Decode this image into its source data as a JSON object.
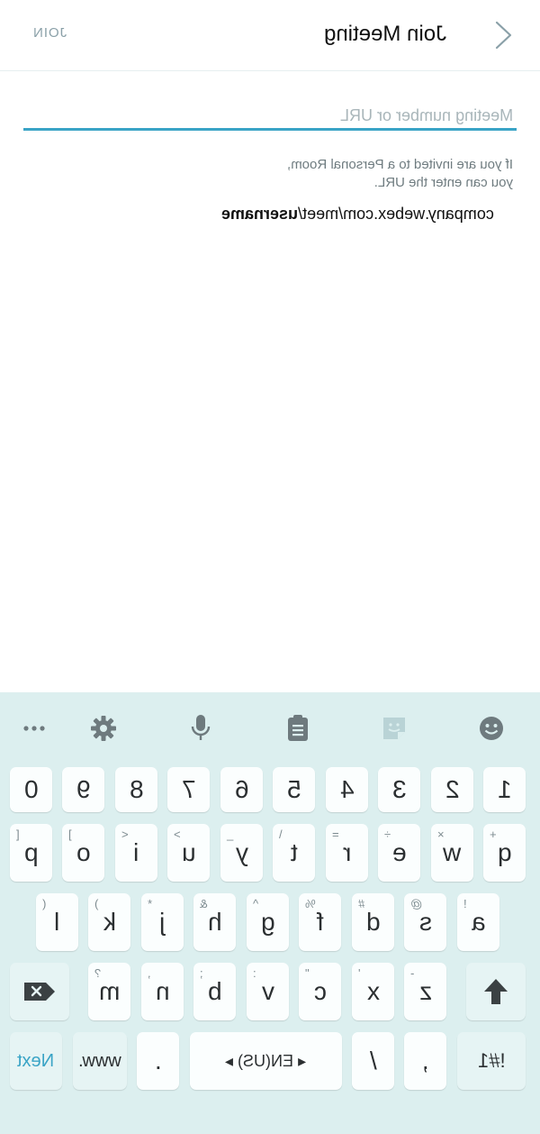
{
  "header": {
    "join_label": "JOIN",
    "title": "Join Meeting"
  },
  "form": {
    "placeholder": "Meeting number or URL",
    "helper_line1": "If you are invited to a Personal Room,",
    "helper_line2": "you can enter the URL.",
    "example_prefix": "company.webex.com/meet/",
    "example_bold": "username"
  },
  "keyboard": {
    "toolbar_icons": [
      "more-icon",
      "gear-icon",
      "microphone-icon",
      "clipboard-icon",
      "sticker-icon",
      "emoji-icon"
    ],
    "row_numbers": [
      "0",
      "9",
      "8",
      "7",
      "6",
      "5",
      "4",
      "3",
      "2",
      "1"
    ],
    "row1": [
      {
        "main": "p",
        "sub": "["
      },
      {
        "main": "o",
        "sub": "]"
      },
      {
        "main": "i",
        "sub": "<"
      },
      {
        "main": "u",
        "sub": ">"
      },
      {
        "main": "y",
        "sub": "_"
      },
      {
        "main": "t",
        "sub": "\\"
      },
      {
        "main": "r",
        "sub": "="
      },
      {
        "main": "e",
        "sub": "÷"
      },
      {
        "main": "w",
        "sub": "×"
      },
      {
        "main": "q",
        "sub": "+"
      }
    ],
    "row2": [
      {
        "main": "l",
        "sub": "("
      },
      {
        "main": "k",
        "sub": ")"
      },
      {
        "main": "j",
        "sub": "*"
      },
      {
        "main": "h",
        "sub": "&"
      },
      {
        "main": "g",
        "sub": "^"
      },
      {
        "main": "f",
        "sub": "%"
      },
      {
        "main": "d",
        "sub": "#"
      },
      {
        "main": "s",
        "sub": "@"
      },
      {
        "main": "a",
        "sub": "!"
      }
    ],
    "row3": [
      {
        "main": "m",
        "sub": "?"
      },
      {
        "main": "n",
        "sub": ","
      },
      {
        "main": "b",
        "sub": ";"
      },
      {
        "main": "v",
        "sub": ":"
      },
      {
        "main": "c",
        "sub": "\""
      },
      {
        "main": "x",
        "sub": "'"
      },
      {
        "main": "z",
        "sub": "-"
      }
    ],
    "bottom": {
      "next": "Next",
      "www": "www.",
      "dot": ".",
      "space": "◂ EN(US) ▸",
      "slash": "/",
      "comma": ",",
      "symbols": "!#1"
    }
  },
  "colors": {
    "accent": "#3aa4c6",
    "keyboard_bg": "#dcefef"
  }
}
